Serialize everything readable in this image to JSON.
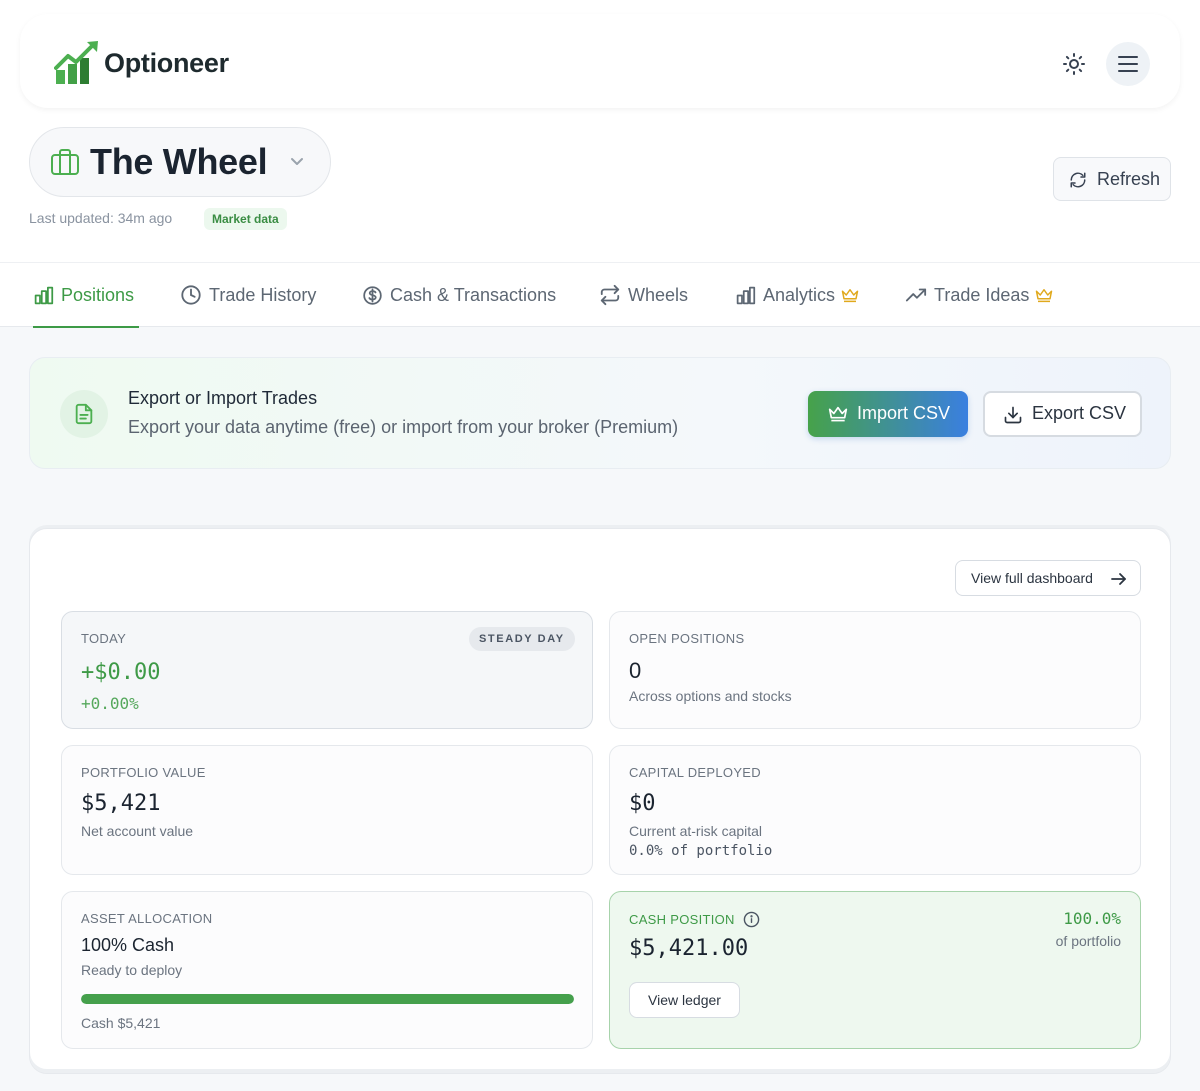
{
  "header": {
    "brand": "Optioneer",
    "icons": {
      "theme": "sun-icon",
      "menu": "hamburger-menu-icon"
    }
  },
  "portfolio": {
    "name": "The Wheel",
    "last_updated": "Last updated: 34m ago",
    "badge": "Market data",
    "refresh_label": "Refresh"
  },
  "tabs": [
    {
      "label": "Positions",
      "icon": "bar-chart-icon",
      "active": true
    },
    {
      "label": "Trade History",
      "icon": "clock-icon",
      "active": false
    },
    {
      "label": "Cash & Transactions",
      "icon": "dollar-circle-icon",
      "active": false
    },
    {
      "label": "Wheels",
      "icon": "repeat-icon",
      "active": false
    },
    {
      "label": "Analytics",
      "icon": "bar-chart-icon",
      "premium": true,
      "active": false
    },
    {
      "label": "Trade Ideas",
      "icon": "trending-up-icon",
      "premium": true,
      "active": false
    }
  ],
  "banner": {
    "title": "Export or Import Trades",
    "subtitle": "Export your data anytime (free) or import from your broker (Premium)",
    "import_label": "Import CSV",
    "export_label": "Export CSV"
  },
  "dashboard": {
    "view_full_label": "View full dashboard",
    "today": {
      "label": "TODAY",
      "badge": "STEADY DAY",
      "value": "+$0.00",
      "percent": "+0.00%"
    },
    "open_positions": {
      "label": "OPEN POSITIONS",
      "value": "0",
      "sub": "Across options and stocks"
    },
    "portfolio_value": {
      "label": "PORTFOLIO VALUE",
      "value": "$5,421",
      "sub": "Net account value"
    },
    "capital_deployed": {
      "label": "CAPITAL DEPLOYED",
      "value": "$0",
      "sub": "Current at-risk capital",
      "pct": "0.0% of portfolio"
    },
    "asset_allocation": {
      "label": "ASSET ALLOCATION",
      "value": "100% Cash",
      "sub": "Ready to deploy",
      "cash_fraction": 1.0,
      "footer": "Cash $5,421"
    },
    "cash_position": {
      "label": "CASH POSITION",
      "value": "$5,421.00",
      "pct": "100.0%",
      "pct_sub": "of portfolio",
      "button": "View ledger"
    }
  },
  "colors": {
    "accent": "#3d9a46",
    "premium": "#e0a91c",
    "import_gradient": [
      "#46a24a",
      "#3a7fe0"
    ]
  }
}
